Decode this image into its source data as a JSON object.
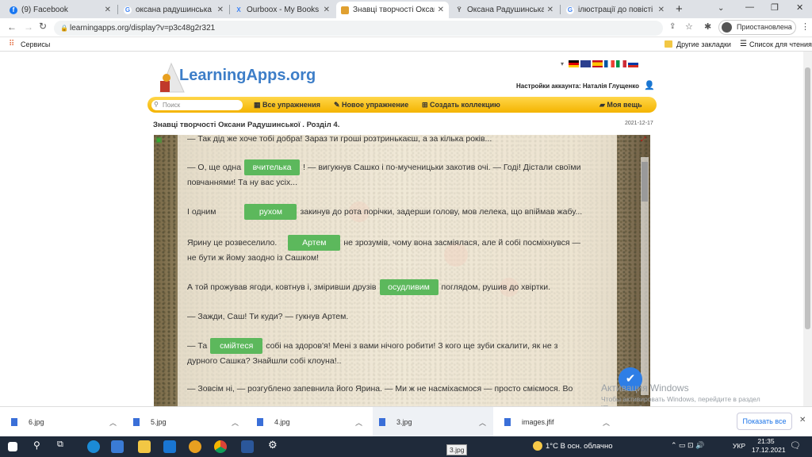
{
  "browser": {
    "tabs": [
      {
        "title": "(9) Facebook",
        "icon": "facebook-icon",
        "color": "#1877f2"
      },
      {
        "title": "оксана радушинська фото",
        "icon": "google-icon",
        "color": "#4285f4"
      },
      {
        "title": "Ourboox - My Books",
        "icon": "ourboox-icon",
        "color": "#3b82f6"
      },
      {
        "title": "Знавці творчості Оксани Р",
        "icon": "learningapps-icon",
        "color": "#e0a030"
      },
      {
        "title": "Оксана Радушинська. «Ме",
        "icon": "wiki-icon",
        "color": "#555555"
      },
      {
        "title": "ілюстрації до повісті мете",
        "icon": "google-icon",
        "color": "#4285f4"
      }
    ],
    "new_tab": "+",
    "url": "learningapps.org/display?v=p3c48g2r321",
    "profile": "Приостановлена",
    "bookmarks": {
      "services": "Сервисы",
      "other": "Другие закладки",
      "reading": "Список для чтения"
    }
  },
  "site": {
    "logo": "LearningApps.org",
    "account_label": "Настройки аккаунта: Наталія Глущенко",
    "search_placeholder": "Поиск",
    "menu": [
      "Все упражнения",
      "Новое упражнение",
      "Создать коллекцию",
      "Моя вещь"
    ],
    "app_title": "Знавці творчості Оксани Радушинської . Розділ 4.",
    "app_date": "2021-12-17"
  },
  "exercise": {
    "line1": "— Так дід же хоче тобі добра! Зараз ти гроші розтринькаєш, а за кілька років...",
    "p2_pre": "— О, ще одна",
    "p2_chip": "вчителька",
    "p2_post": "! — вигукнув Сашко і по-мученицьки закотив очі. — Годі! Дістали своїми",
    "p2_line2": "повчаннями! Та ну вас усіх...",
    "p3_pre": "І одним",
    "p3_chip": "рухом",
    "p3_post": "закинув до рота порічки, задерши голову, мов лелека, що впіймав жабу...",
    "p4_pre": "Ярину це розвеселило.",
    "p4_chip": "Артем",
    "p4_post": "не зрозумів, чому вона засміялася, але й собі посміхнувся —",
    "p4_line2": "не бути ж йому заодно із Сашком!",
    "p5_pre": "А той прожував ягоди, ковтнув і, зміривши друзів",
    "p5_chip": "осудливим",
    "p5_post": "поглядом, рушив до хвіртки.",
    "p6": "— Зажди, Саш! Ти куди? — гукнув Артем.",
    "p7_pre": "— Та",
    "p7_chip": "смійтеся",
    "p7_post": "собі на здоров'я! Мені з вами нічого робити! З кого ще зуби скалити, як не з",
    "p7_line2": "дурного Сашка? Знайшли собі клоуна!..",
    "p8": "— Зовсім ні, — розгублено запевнила його Ярина. — Ми ж не насміхаємося — просто сміємося. Во"
  },
  "windows_notice": {
    "title": "Активация Windows",
    "body": "Чтобы активировать Windows, перейдите в раздел \"Параметры\"."
  },
  "downloads": {
    "items": [
      "6.jpg",
      "5.jpg",
      "4.jpg",
      "3.jpg",
      "images.jfif"
    ],
    "show_all": "Показать все",
    "tooltip": "3.jpg"
  },
  "taskbar": {
    "weather": "1°C  В осн. облачно",
    "lang": "УКР",
    "time": "21:35",
    "date": "17.12.2021"
  },
  "colors": {
    "chip": "#5cb85c",
    "menu": "#f4b400",
    "logo": "#3d7ec8"
  }
}
